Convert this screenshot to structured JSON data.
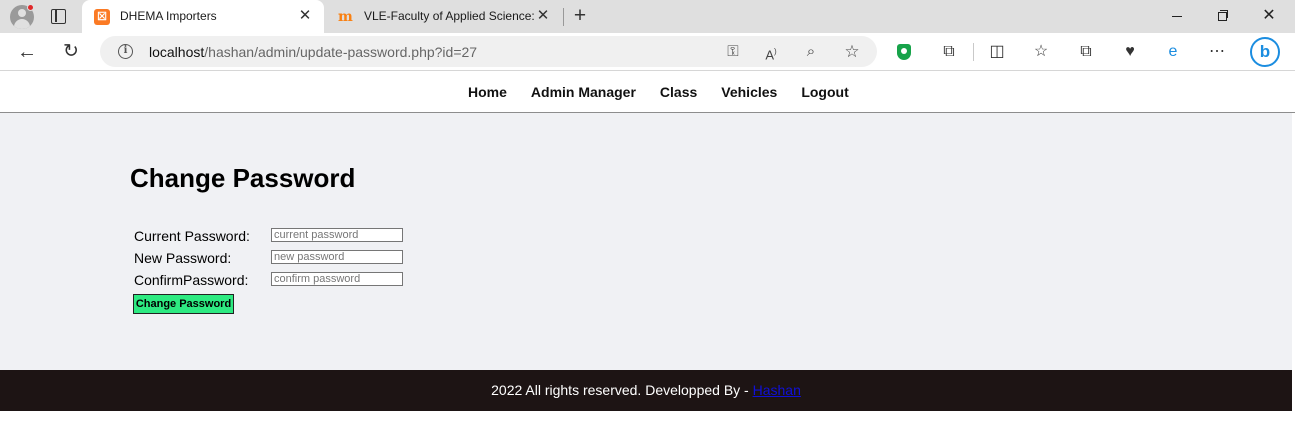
{
  "browser": {
    "tabs": [
      {
        "title": "DHEMA Importers",
        "favicon": "xampp-icon",
        "active": true
      },
      {
        "title": "VLE-Faculty of Applied Science: L",
        "favicon": "moodle-icon",
        "active": false
      }
    ],
    "address": {
      "host": "localhost",
      "path": "/hashan/admin/update-password.php?id=27"
    },
    "icons": {
      "new_tab": "+",
      "close": "✕",
      "back": "←",
      "reload": "↻",
      "more": "⋯"
    }
  },
  "nav": {
    "links": [
      "Home",
      "Admin Manager",
      "Class",
      "Vehicles",
      "Logout"
    ]
  },
  "form": {
    "title": "Change Password",
    "current_label": "Current Password:",
    "current_placeholder": "current password",
    "new_label": "New Password:",
    "new_placeholder": "new password",
    "confirm_label": "ConfirmPassword:",
    "confirm_placeholder": "confirm password",
    "submit_label": "Change Password"
  },
  "footer": {
    "text": "2022 All rights reserved. Developped By - ",
    "link_text": "Hashan"
  },
  "colors": {
    "content_bg": "#f0f1f4",
    "button_bg": "#2dea81",
    "footer_bg": "#1d1414",
    "link": "#1010d8"
  }
}
